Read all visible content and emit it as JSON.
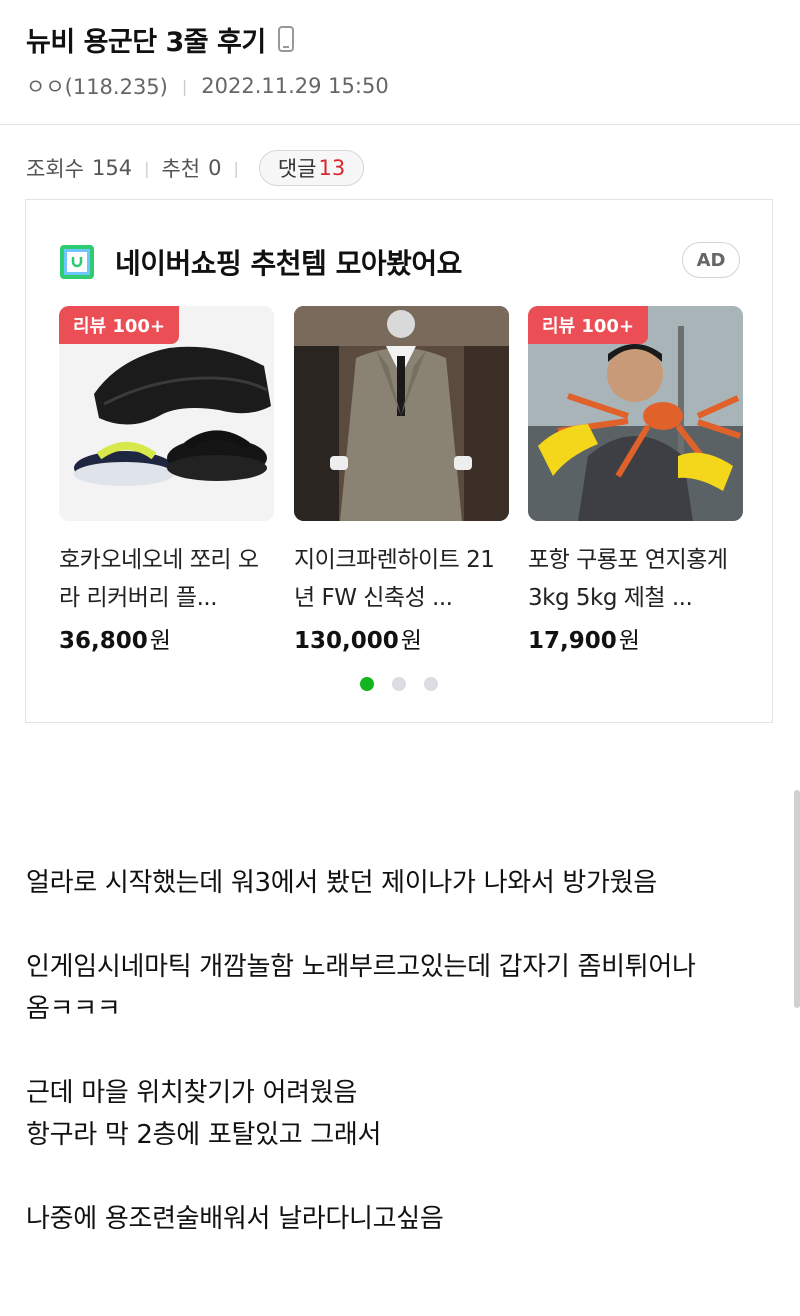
{
  "post": {
    "title": "뉴비 용군단 3줄 후기",
    "author": "ㅇㅇ(118.235)",
    "datetime": "2022.11.29 15:50",
    "views_label": "조회수",
    "views": "154",
    "recommend_label": "추천",
    "recommend": "0",
    "comments_label": "댓글",
    "comments": "13",
    "body": [
      "얼라로 시작했는데 워3에서 봤던 제이나가 나와서 방가웠음",
      "",
      "인게임시네마틱 개깜놀함 노래부르고있는데 갑자기 좀비튀어나",
      "옴ㅋㅋㅋ",
      "",
      "근데 마을 위치찾기가 어려웠음",
      "항구라 막 2층에 포탈있고 그래서",
      "",
      "나중에 용조련술배워서 날라다니고싶음"
    ]
  },
  "ad": {
    "title": "네이버쇼핑 추천템 모아봤어요",
    "badge": "AD",
    "products": [
      {
        "badge": "리뷰 100+",
        "name": "호카오네오네 쪼리 오라 리커버리 플...",
        "price": "36,800",
        "currency": "원"
      },
      {
        "badge": "",
        "name": "지이크파렌하이트 21년 FW 신축성 ...",
        "price": "130,000",
        "currency": "원"
      },
      {
        "badge": "리뷰 100+",
        "name": "포항 구룡포 연지홍게 3kg 5kg 제철 ...",
        "price": "17,900",
        "currency": "원"
      }
    ],
    "page_dots": 3,
    "active_dot": 0
  },
  "colors": {
    "accent_red": "#d8282d",
    "badge_red": "#ec4e55",
    "dot_active": "#12b51f"
  }
}
